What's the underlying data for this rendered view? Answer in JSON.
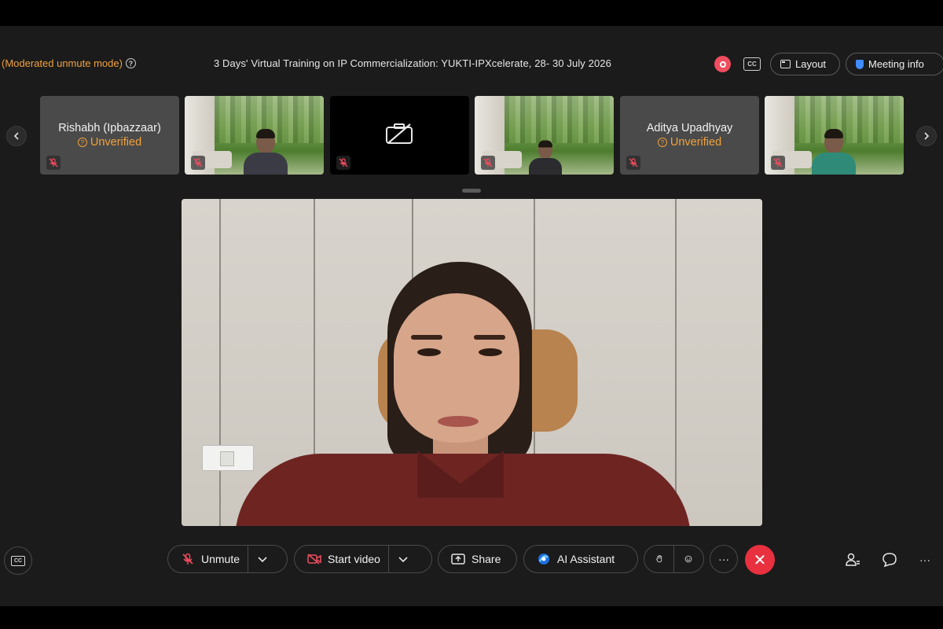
{
  "header": {
    "mode_label": "(Moderated unmute mode)",
    "meeting_title": "3 Days' Virtual Training on IP Commercialization: YUKTI-IPXcelerate, 28- 30 July 2026",
    "cc_label": "CC",
    "layout_label": "Layout",
    "meeting_info_label": "Meeting info",
    "record_color": "#f04d5e"
  },
  "participants": [
    {
      "type": "name",
      "name": "Rishabh (Ipbazzaar)",
      "status": "Unverified",
      "muted": true
    },
    {
      "type": "video",
      "muted": true
    },
    {
      "type": "camera-off",
      "muted": true
    },
    {
      "type": "video",
      "muted": true
    },
    {
      "type": "name",
      "name": "Aditya Upadhyay",
      "status": "Unverified",
      "muted": true
    },
    {
      "type": "video",
      "muted": true
    }
  ],
  "controls": {
    "unmute_label": "Unmute",
    "start_video_label": "Start video",
    "share_label": "Share",
    "ai_assistant_label": "AI Assistant",
    "more_label": "···",
    "end_label": "✕",
    "cc_label": "CC"
  },
  "colors": {
    "accent_orange": "#f0a13c",
    "end_call_red": "#e8303f",
    "background": "#1b1b1b"
  }
}
